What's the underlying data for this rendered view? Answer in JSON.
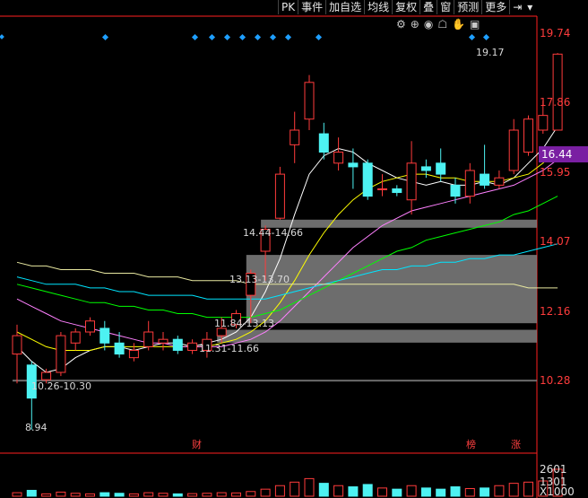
{
  "toolbar": {
    "items": [
      "PK",
      "事件",
      "加自选",
      "均线",
      "复权",
      "叠",
      "窗",
      "预测",
      "更多"
    ],
    "icon_arrow": "pin-right-icon",
    "icon_dropdown": "chevron-down-icon"
  },
  "iconbar": [
    "settings-icon",
    "zoom-icon",
    "eye-icon",
    "lock-icon",
    "hand-icon",
    "gift-icon"
  ],
  "price_axis": {
    "ticks": [
      "19.74",
      "17.86",
      "15.95",
      "14.07",
      "12.16",
      "10.28"
    ],
    "current": "16.44",
    "current_color": "#7a1fa2"
  },
  "annotations": {
    "high_label": "19.17",
    "low_label": "8.94",
    "gap1": "14.44-14.66",
    "gap2": "13.13-13.70",
    "gap3": "11.84-13.13",
    "gap4": "11.31-11.66",
    "gap5": "10.26-10.30"
  },
  "events": {
    "cai": "财",
    "bang": "榜",
    "zhang": "涨"
  },
  "volume_axis": {
    "top": "2601",
    "mid": "1301",
    "unit": "X1000"
  },
  "chart_data": {
    "type": "candlestick",
    "ylim": [
      8.5,
      20.0
    ],
    "candles": [
      {
        "o": 11.0,
        "c": 11.5,
        "h": 11.8,
        "l": 10.2
      },
      {
        "o": 10.7,
        "c": 9.8,
        "h": 10.8,
        "l": 8.94
      },
      {
        "o": 10.3,
        "c": 10.5,
        "h": 10.6,
        "l": 10.2
      },
      {
        "o": 10.5,
        "c": 11.5,
        "h": 11.6,
        "l": 10.4
      },
      {
        "o": 11.3,
        "c": 11.6,
        "h": 11.7,
        "l": 11.1
      },
      {
        "o": 11.6,
        "c": 11.9,
        "h": 12.0,
        "l": 11.5
      },
      {
        "o": 11.7,
        "c": 11.3,
        "h": 11.9,
        "l": 11.1
      },
      {
        "o": 11.3,
        "c": 11.0,
        "h": 11.6,
        "l": 10.9
      },
      {
        "o": 10.9,
        "c": 11.1,
        "h": 11.3,
        "l": 10.8
      },
      {
        "o": 11.2,
        "c": 11.6,
        "h": 11.9,
        "l": 11.1
      },
      {
        "o": 11.3,
        "c": 11.4,
        "h": 11.6,
        "l": 11.1
      },
      {
        "o": 11.4,
        "c": 11.1,
        "h": 11.5,
        "l": 11.0
      },
      {
        "o": 11.1,
        "c": 11.3,
        "h": 11.4,
        "l": 11.0
      },
      {
        "o": 11.1,
        "c": 11.4,
        "h": 11.6,
        "l": 10.9
      },
      {
        "o": 11.5,
        "c": 11.7,
        "h": 12.0,
        "l": 11.3
      },
      {
        "o": 11.8,
        "c": 12.1,
        "h": 12.2,
        "l": 11.7
      },
      {
        "o": 12.6,
        "c": 13.2,
        "h": 13.3,
        "l": 11.84
      },
      {
        "o": 13.8,
        "c": 14.4,
        "h": 14.5,
        "l": 13.0
      },
      {
        "o": 14.7,
        "c": 15.9,
        "h": 16.1,
        "l": 14.66
      },
      {
        "o": 16.7,
        "c": 17.1,
        "h": 17.6,
        "l": 16.2
      },
      {
        "o": 17.4,
        "c": 18.4,
        "h": 18.6,
        "l": 17.1
      },
      {
        "o": 17.0,
        "c": 16.5,
        "h": 17.3,
        "l": 16.3
      },
      {
        "o": 16.2,
        "c": 16.5,
        "h": 16.9,
        "l": 16.0
      },
      {
        "o": 16.2,
        "c": 16.1,
        "h": 16.6,
        "l": 15.5
      },
      {
        "o": 16.2,
        "c": 15.3,
        "h": 16.3,
        "l": 15.2
      },
      {
        "o": 15.5,
        "c": 15.5,
        "h": 15.9,
        "l": 15.3
      },
      {
        "o": 15.5,
        "c": 15.4,
        "h": 15.6,
        "l": 15.3
      },
      {
        "o": 15.2,
        "c": 16.2,
        "h": 16.8,
        "l": 14.8
      },
      {
        "o": 16.1,
        "c": 16.0,
        "h": 16.3,
        "l": 15.8
      },
      {
        "o": 16.2,
        "c": 15.9,
        "h": 16.6,
        "l": 15.7
      },
      {
        "o": 15.6,
        "c": 15.3,
        "h": 15.8,
        "l": 15.1
      },
      {
        "o": 15.3,
        "c": 16.0,
        "h": 16.2,
        "l": 15.1
      },
      {
        "o": 15.9,
        "c": 15.6,
        "h": 16.7,
        "l": 15.5
      },
      {
        "o": 15.6,
        "c": 15.8,
        "h": 16.0,
        "l": 15.5
      },
      {
        "o": 16.0,
        "c": 17.1,
        "h": 17.4,
        "l": 15.9
      },
      {
        "o": 16.5,
        "c": 17.4,
        "h": 17.5,
        "l": 16.4
      },
      {
        "o": 17.1,
        "c": 17.5,
        "h": 17.9,
        "l": 17.0
      },
      {
        "o": 17.1,
        "c": 19.17,
        "h": 19.2,
        "l": 17.1
      }
    ],
    "gaps": [
      {
        "lo": 14.44,
        "hi": 14.66
      },
      {
        "lo": 11.84,
        "hi": 13.7
      },
      {
        "lo": 11.31,
        "hi": 11.66
      },
      {
        "lo": 10.26,
        "hi": 10.3
      }
    ],
    "ma_series": [
      {
        "color": "#ffffff",
        "values": [
          11.2,
          10.8,
          10.5,
          10.6,
          10.9,
          11.1,
          11.2,
          11.2,
          11.1,
          11.2,
          11.3,
          11.3,
          11.2,
          11.3,
          11.4,
          11.6,
          12.0,
          12.7,
          13.6,
          14.8,
          15.9,
          16.4,
          16.6,
          16.5,
          16.2,
          16.0,
          15.8,
          15.7,
          15.6,
          15.7,
          15.6,
          15.6,
          15.7,
          15.6,
          15.8,
          16.2,
          16.6,
          17.2
        ]
      },
      {
        "color": "#ffff00",
        "values": [
          11.6,
          11.4,
          11.2,
          11.1,
          11.1,
          11.1,
          11.2,
          11.2,
          11.2,
          11.2,
          11.2,
          11.2,
          11.2,
          11.2,
          11.3,
          11.4,
          11.6,
          11.9,
          12.4,
          13.0,
          13.7,
          14.3,
          14.8,
          15.2,
          15.5,
          15.7,
          15.8,
          15.9,
          15.9,
          15.8,
          15.8,
          15.7,
          15.7,
          15.7,
          15.8,
          15.9,
          16.2,
          16.6
        ]
      },
      {
        "color": "#ff80ff",
        "values": [
          12.5,
          12.3,
          12.1,
          11.9,
          11.8,
          11.7,
          11.6,
          11.5,
          11.4,
          11.3,
          11.3,
          11.2,
          11.2,
          11.2,
          11.2,
          11.3,
          11.4,
          11.6,
          11.9,
          12.3,
          12.7,
          13.1,
          13.5,
          13.9,
          14.2,
          14.5,
          14.7,
          14.9,
          15.0,
          15.1,
          15.2,
          15.3,
          15.4,
          15.5,
          15.6,
          15.8,
          16.0,
          16.3
        ]
      },
      {
        "color": "#00ff00",
        "values": [
          12.9,
          12.8,
          12.7,
          12.6,
          12.5,
          12.4,
          12.4,
          12.3,
          12.3,
          12.2,
          12.2,
          12.1,
          12.1,
          12.0,
          12.0,
          12.0,
          12.0,
          12.1,
          12.2,
          12.4,
          12.6,
          12.8,
          13.0,
          13.2,
          13.4,
          13.6,
          13.8,
          13.9,
          14.1,
          14.2,
          14.3,
          14.4,
          14.5,
          14.6,
          14.8,
          14.9,
          15.1,
          15.3
        ]
      },
      {
        "color": "#00e5ff",
        "values": [
          13.1,
          13.0,
          12.9,
          12.9,
          12.9,
          12.8,
          12.8,
          12.7,
          12.7,
          12.6,
          12.6,
          12.6,
          12.6,
          12.5,
          12.5,
          12.5,
          12.5,
          12.5,
          12.6,
          12.7,
          12.8,
          12.9,
          13.0,
          13.1,
          13.2,
          13.3,
          13.3,
          13.4,
          13.4,
          13.5,
          13.5,
          13.6,
          13.6,
          13.7,
          13.7,
          13.8,
          13.9,
          14.0
        ]
      },
      {
        "color": "#e8e8a0",
        "values": [
          13.5,
          13.4,
          13.4,
          13.3,
          13.3,
          13.3,
          13.2,
          13.2,
          13.2,
          13.1,
          13.1,
          13.1,
          13.0,
          13.0,
          13.0,
          13.0,
          12.9,
          12.9,
          12.9,
          12.9,
          12.9,
          12.9,
          12.9,
          12.9,
          12.9,
          12.9,
          12.9,
          12.9,
          12.9,
          12.9,
          12.9,
          12.9,
          12.9,
          12.9,
          12.9,
          12.8,
          12.8,
          12.8
        ]
      }
    ],
    "volume": [
      300,
      500,
      200,
      350,
      250,
      200,
      300,
      250,
      200,
      300,
      250,
      200,
      220,
      250,
      300,
      280,
      400,
      600,
      900,
      1200,
      1500,
      1100,
      900,
      800,
      1000,
      700,
      600,
      900,
      700,
      600,
      800,
      650,
      700,
      900,
      1100,
      1200,
      1300,
      2300
    ]
  }
}
